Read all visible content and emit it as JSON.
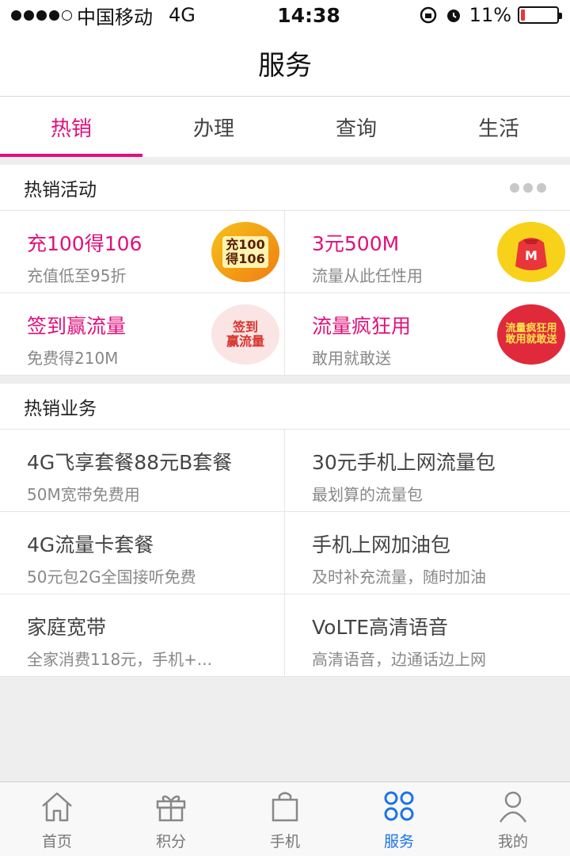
{
  "status_bar": {
    "carrier": "中国移动",
    "network": "4G",
    "time": "14:38",
    "battery": "11%"
  },
  "header": {
    "title": "服务"
  },
  "tabs": [
    {
      "label": "热销",
      "active": true
    },
    {
      "label": "办理",
      "active": false
    },
    {
      "label": "查询",
      "active": false
    },
    {
      "label": "生活",
      "active": false
    }
  ],
  "hot_activities": {
    "title": "热销活动",
    "items": [
      {
        "title": "充100得106",
        "subtitle": "充值低至95折",
        "badge_text": "充100\n得106",
        "icon": "recharge-badge-icon"
      },
      {
        "title": "3元500M",
        "subtitle": "流量从此任性用",
        "badge_text": "M",
        "icon": "red-envelope-icon"
      },
      {
        "title": "签到赢流量",
        "subtitle": "免费得210M",
        "badge_text": "签到\n赢流量",
        "icon": "signin-badge-icon"
      },
      {
        "title": "流量疯狂用",
        "subtitle": "敢用就敢送",
        "badge_text": "流量疯狂用\n敢用就敢送",
        "icon": "data-crazy-badge-icon"
      }
    ]
  },
  "hot_business": {
    "title": "热销业务",
    "items": [
      {
        "title": "4G飞享套餐88元B套餐",
        "subtitle": "50M宽带免费用"
      },
      {
        "title": "30元手机上网流量包",
        "subtitle": "最划算的流量包"
      },
      {
        "title": "4G流量卡套餐",
        "subtitle": "50元包2G全国接听免费"
      },
      {
        "title": "手机上网加油包",
        "subtitle": "及时补充流量，随时加油"
      },
      {
        "title": "家庭宽带",
        "subtitle": "全家消费118元，手机+..."
      },
      {
        "title": "VoLTE高清语音",
        "subtitle": "高清语音，边通话边上网"
      }
    ]
  },
  "tabbar": [
    {
      "label": "首页",
      "icon": "home-icon",
      "active": false
    },
    {
      "label": "积分",
      "icon": "gift-icon",
      "active": false
    },
    {
      "label": "手机",
      "icon": "shopping-bag-icon",
      "active": false
    },
    {
      "label": "服务",
      "icon": "service-grid-icon",
      "active": true
    },
    {
      "label": "我的",
      "icon": "user-icon",
      "active": false
    }
  ],
  "colors": {
    "accent": "#e0107b",
    "tab_active": "#1a73e8"
  }
}
